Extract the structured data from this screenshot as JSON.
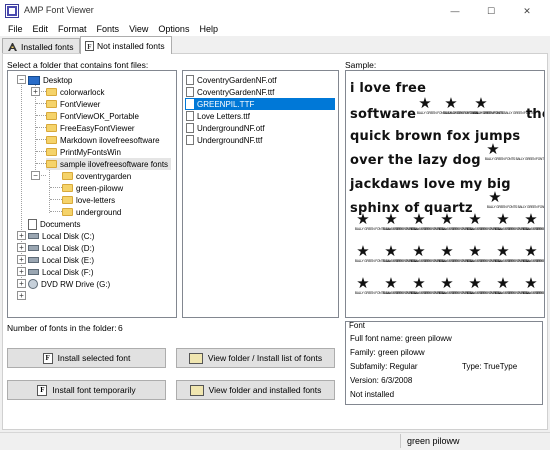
{
  "window": {
    "title": "AMP Font Viewer",
    "minimize_glyph": "—",
    "maximize_glyph": "☐",
    "close_glyph": "✕"
  },
  "menu": [
    "File",
    "Edit",
    "Format",
    "Fonts",
    "View",
    "Options",
    "Help"
  ],
  "tabs": {
    "installed": "Installed fonts",
    "not_installed": "Not installed fonts",
    "active": "not_installed"
  },
  "folder_panel": {
    "label": "Select a folder that contains font files:",
    "tree": [
      {
        "label": "Desktop",
        "icon": "desktop-icon"
      },
      {
        "label": "colorwarlock",
        "icon": "folder-icon"
      },
      {
        "label": "FontViewer",
        "icon": "folder-icon"
      },
      {
        "label": "FontViewOK_Portable",
        "icon": "folder-icon"
      },
      {
        "label": "FreeEasyFontViewer",
        "icon": "folder-icon"
      },
      {
        "label": "Markdown ilovefreesoftware",
        "icon": "folder-icon"
      },
      {
        "label": "PrintMyFontsWin",
        "icon": "folder-icon"
      },
      {
        "label": "sample ilovefreesoftware fonts",
        "icon": "folder-icon"
      },
      {
        "label": "coventrygarden",
        "icon": "folder-icon"
      },
      {
        "label": "green-piloww",
        "icon": "folder-icon"
      },
      {
        "label": "love-letters",
        "icon": "folder-icon"
      },
      {
        "label": "underground",
        "icon": "folder-icon"
      },
      {
        "label": "Documents",
        "icon": "documents-icon"
      },
      {
        "label": "Local Disk (C:)",
        "icon": "drive-icon"
      },
      {
        "label": "Local Disk (D:)",
        "icon": "drive-icon"
      },
      {
        "label": "Local Disk (E:)",
        "icon": "drive-icon"
      },
      {
        "label": "Local Disk (F:)",
        "icon": "drive-icon"
      },
      {
        "label": "DVD RW Drive (G:)",
        "icon": "dvd-icon"
      }
    ],
    "expander_plus": "+",
    "expander_minus": "−"
  },
  "file_list": {
    "files": [
      "CoventryGardenNF.otf",
      "CoventryGardenNF.ttf",
      "GREENPIL.TTF",
      "Love Letters.ttf",
      "UndergroundNF.otf",
      "UndergroundNF.ttf"
    ],
    "selected": "GREENPIL.TTF"
  },
  "sample": {
    "label": "Sample:",
    "lines": [
      "i love free",
      "software",
      "the",
      "quick brown fox jumps",
      "over the lazy dog",
      "jackdaws love my big",
      "sphinx of quartz"
    ],
    "glyph_star": "★",
    "glyph_caption": "BALLY GREEN FONTS BALLY GREEN FONTS"
  },
  "font_count": {
    "label": "Number of fonts in the folder:",
    "value": "6"
  },
  "font_info": {
    "title": "Font",
    "full_name": "Full font name:  green piloww",
    "family": "Family:  green piloww",
    "subfamily": "Subfamily:  Regular",
    "type": "Type:  TrueType",
    "version": "Version:  6/3/2008",
    "status": "Not installed"
  },
  "buttons": {
    "install_selected": "Install selected font",
    "install_temporarily": "Install font temporarily",
    "view_folder_install_list": "View folder / Install list of fonts",
    "view_folder_and_installed": "View folder and installed fonts"
  },
  "statusbar": {
    "text": "green piloww"
  }
}
